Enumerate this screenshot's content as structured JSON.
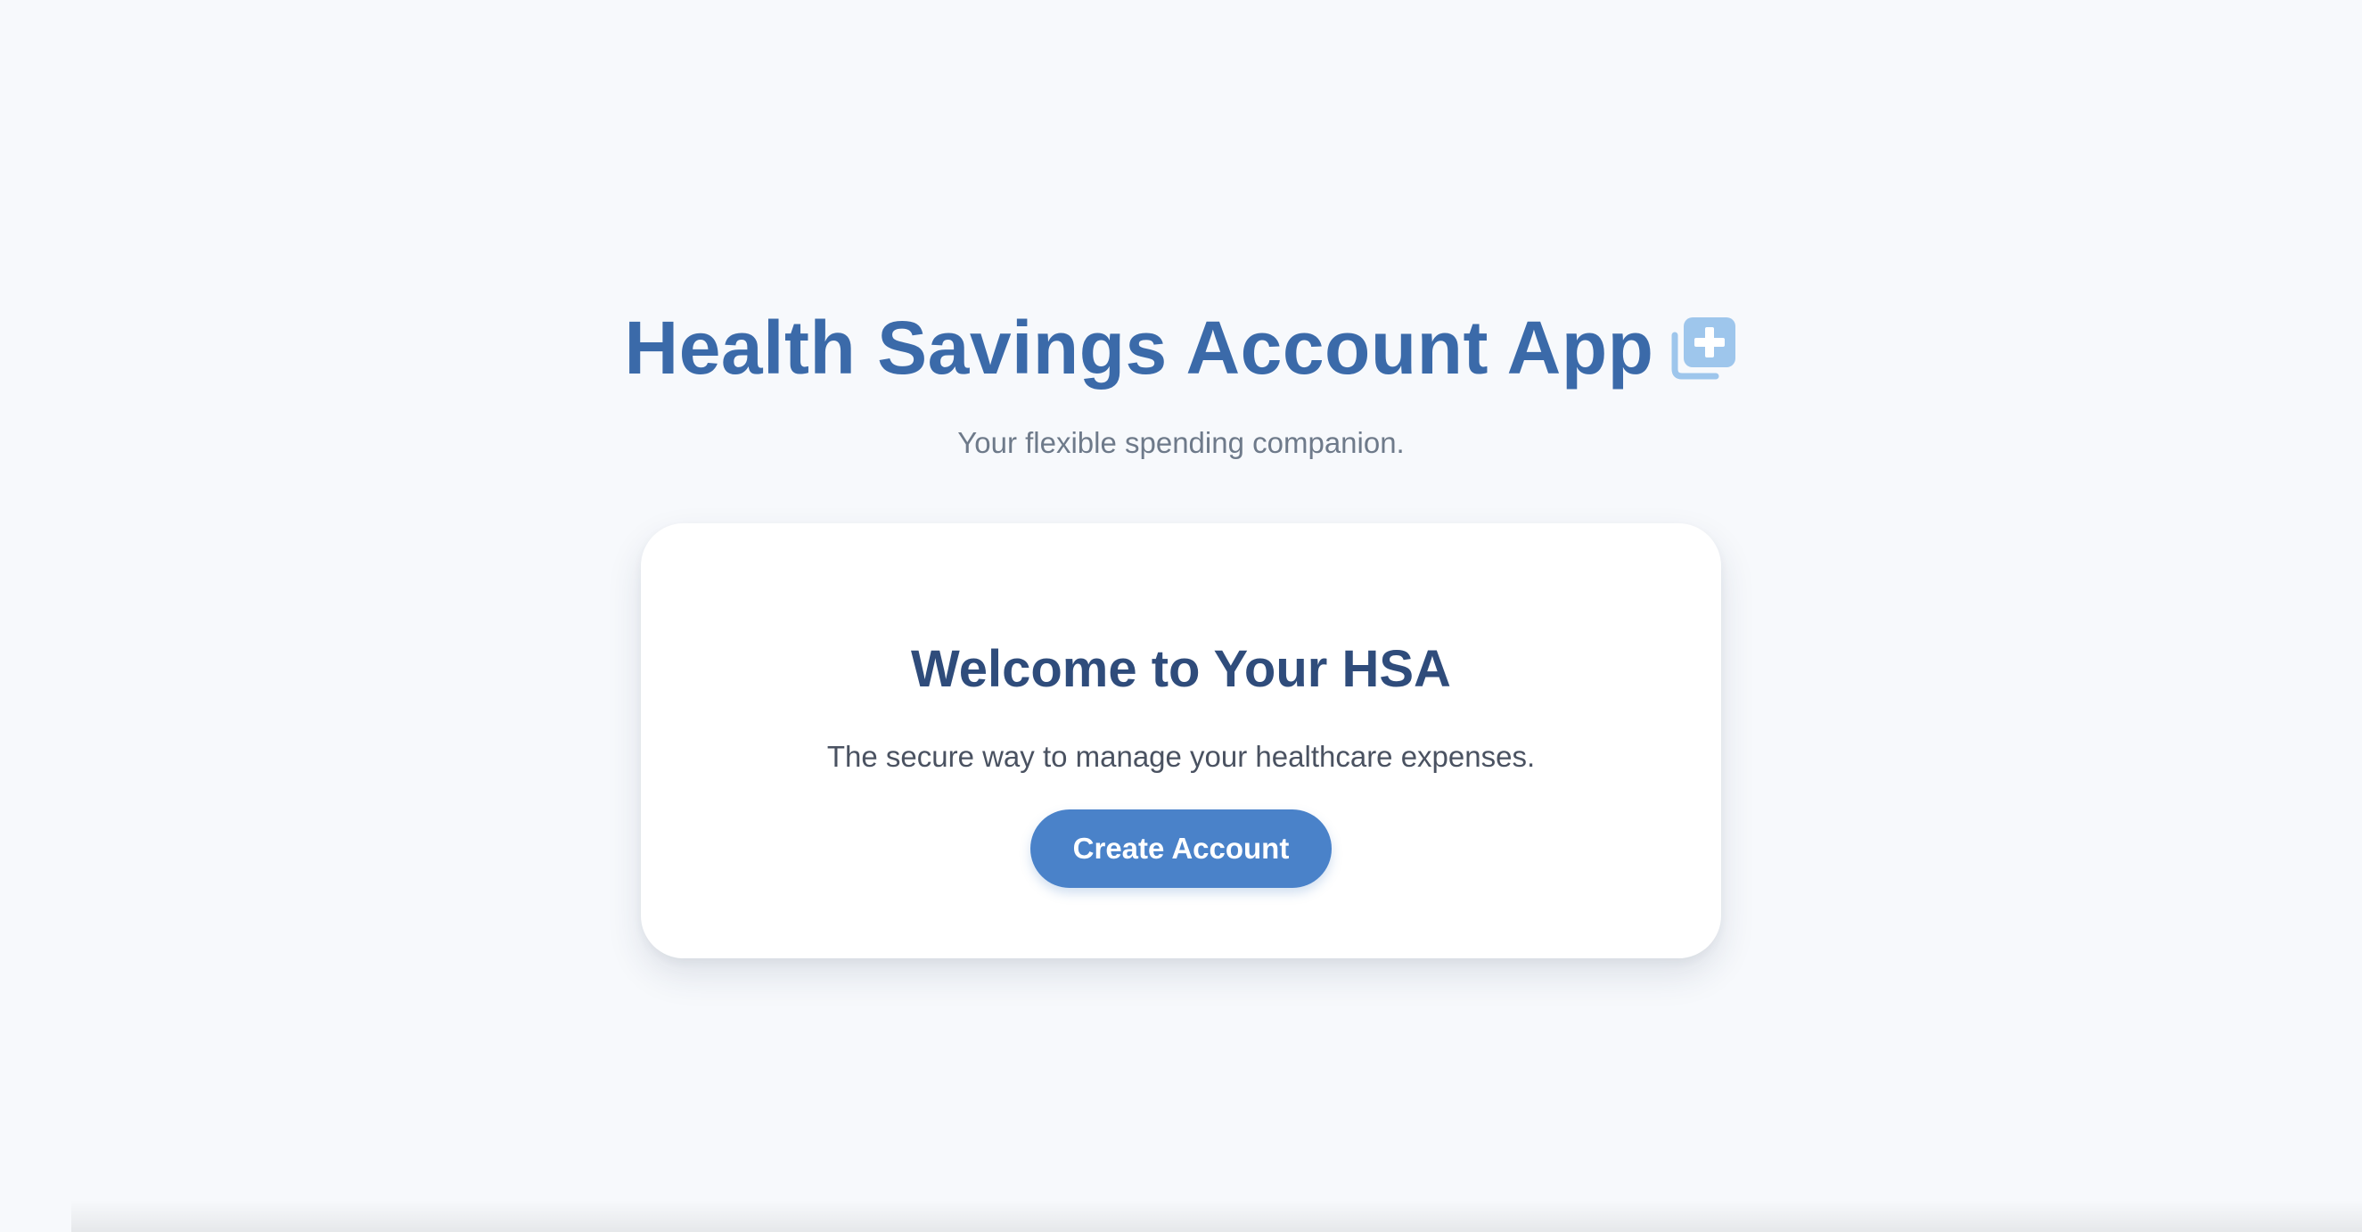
{
  "header": {
    "title": "Health Savings Account App",
    "subtitle": "Your flexible spending companion.",
    "icon": "medical-plus-icon"
  },
  "welcome_card": {
    "title": "Welcome to Your HSA",
    "description": "The secure way to manage your healthcare expenses.",
    "button_label": "Create Account"
  },
  "colors": {
    "background": "#f7f9fc",
    "title": "#3b6aa9",
    "card_title": "#2f4c7b",
    "button": "#4a82c9",
    "icon": "#9ec6ec"
  }
}
